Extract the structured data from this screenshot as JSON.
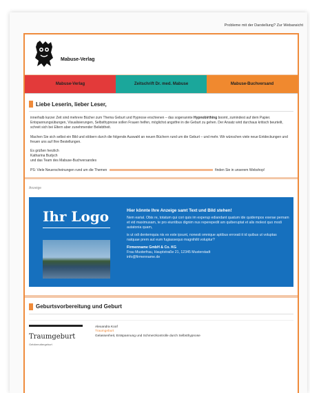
{
  "topbar": {
    "link": "Probleme mit der Darstellung? Zur Webansicht"
  },
  "header": {
    "brand": "Mabuse-Verlag"
  },
  "nav": {
    "tabs": [
      {
        "label": "Mabuse-Verlag",
        "color": "#e33a3a"
      },
      {
        "label": "Zeitschrift Dr. med. Mabuse",
        "color": "#1ba79b"
      },
      {
        "label": "Mabuse-Buchversand",
        "color": "#f0892f"
      }
    ]
  },
  "letter": {
    "heading": "Liebe Leserin, lieber Leser,",
    "p1_start": "innerhalb kurzer Zeit sind mehrere Bücher zum Thema Geburt und Hypnose erschienen – das sogenannte",
    "p1_bold": "Hypnobirthing",
    "p1_end": "boomt, zumindest auf dem Papier. Entspannungsübungen, Visualisierungen, Selbsthypnose sollen Frauen helfen, möglichst angstfrei in die Geburt zu gehen. Der Ansatz wird durchaus kritisch beurteilt, schreit sich bei Eltern aber zunehmender Beliebtheit.",
    "p2": "Machen Sie sich selbst ein Bild und stöbern durch die folgende Auswahl an neuen Büchern rund um die Geburt – und mehr. Wir wünschen viele neue Entdeckungen und freuen uns auf Ihre Bestellungen.",
    "greeting1": "Es grüßen herzlich",
    "greeting2": "Katharina Budych",
    "greeting3": "und das Team des Mabuse-Buchversandes",
    "ps_start": "PS: Viele Neuerscheinungen rund um die Themen",
    "ps_end": "finden Sie in unserem Webshop!"
  },
  "ad": {
    "label": "Anzeige",
    "logo": "Ihr Logo",
    "headline": "Hier könnte Ihre Anzeige samt Text und Bild stehen!",
    "body1": "Nem earial. Obis re, totatum qui cori quis im experup ediandant quatum ide quidempos exerae pernam et vid maximusam, te pro eiuntibus dignim nus reperepedit am quiberuptat et alis molest quo modi autatonia quam,",
    "body2": "is ut odi dentemquia nis ex este ipsunt, nonesti omnique aptibus errorati it id quibus ut voluptas natquae prem aut eum fugiassequo magnihilit voluptur?",
    "company": "Firmenname GmbH & Co. KG",
    "address": "Frau Musterfrau, Hauptstraße 21, 12345 Musterstadt",
    "email": "info@firmenname.de"
  },
  "section2": {
    "heading": "Geburtsvorbereitung und Geburt",
    "book": {
      "cover_title": "Traumgeburt",
      "cover_sub": "Gebärmuttergeburt",
      "author": "Alexandra Koof",
      "title": "Traumgeburt",
      "desc": "Gelassenheit, Entspannung und Schmerzkontrolle durch Selbsthypnose"
    }
  }
}
